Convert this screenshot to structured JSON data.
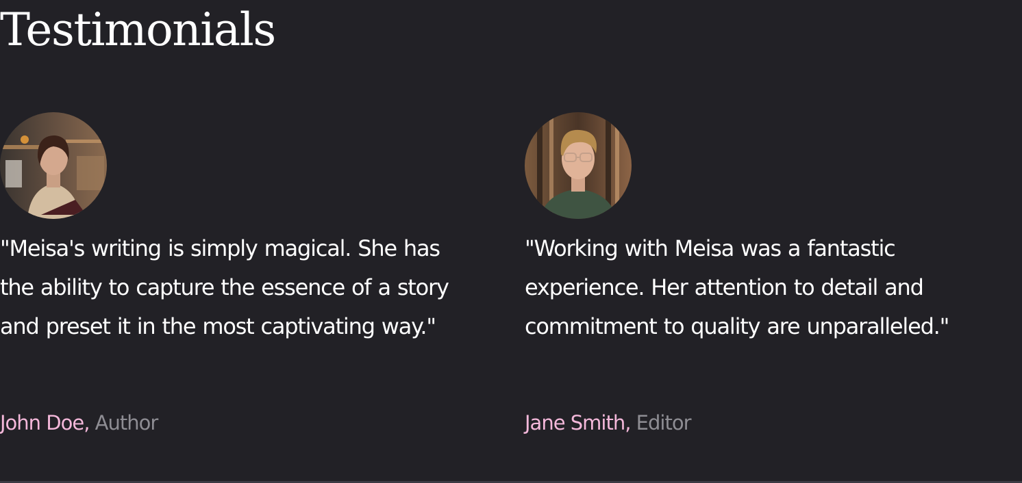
{
  "section": {
    "title": "Testimonials"
  },
  "testimonials": [
    {
      "avatar": "woman-reading-portrait",
      "quote": "\"Meisa's writing is simply magical. She has the ability to capture the essence of a story and preset it in the most captivating way.\"",
      "name": "John Doe,",
      "role": "Author"
    },
    {
      "avatar": "man-glasses-portrait",
      "quote": "\"Working with Meisa was a fantastic experience. Her attention to detail and commitment to quality are unparalleled.\"",
      "name": "Jane Smith,",
      "role": "Editor"
    }
  ],
  "colors": {
    "background": "#222126",
    "text": "#ffffff",
    "author_name": "#f4b8da",
    "author_role": "#8e8d93",
    "divider": "#3c3b44"
  }
}
